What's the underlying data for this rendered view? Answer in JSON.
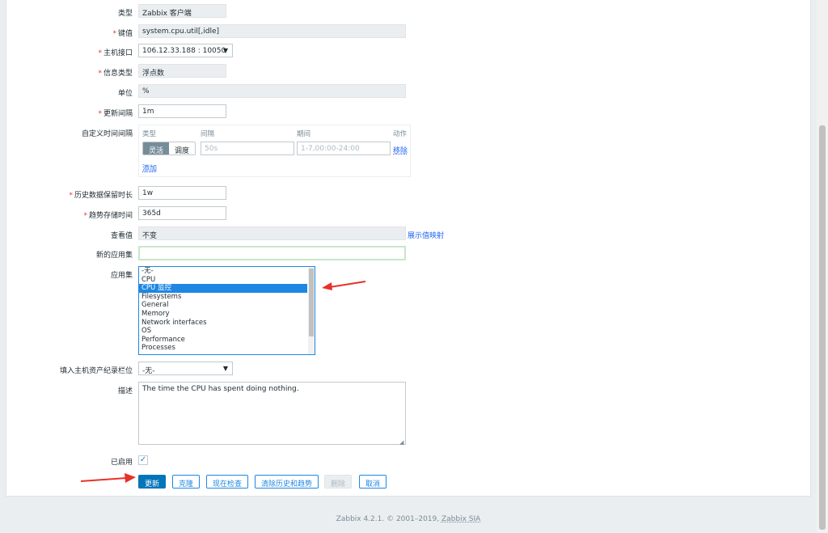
{
  "form": {
    "type": {
      "label": "类型",
      "value": "Zabbix 客户端"
    },
    "key": {
      "label": "键值",
      "value": "system.cpu.util[,idle]"
    },
    "interface": {
      "label": "主机接口",
      "value": "106.12.33.188 : 10050"
    },
    "info_type": {
      "label": "信息类型",
      "value": "浮点数"
    },
    "units": {
      "label": "单位",
      "value": "%"
    },
    "interval": {
      "label": "更新间隔",
      "value": "1m"
    },
    "custom_intervals": {
      "label": "自定义时间间隔",
      "col_type": "类型",
      "col_interval": "间隔",
      "col_period": "期间",
      "col_action": "动作",
      "flexible": "灵活",
      "scheduling": "调度",
      "interval_placeholder": "50s",
      "period_placeholder": "1-7,00:00-24:00",
      "remove": "移除",
      "add": "添加"
    },
    "history": {
      "label": "历史数据保留时长",
      "value": "1w"
    },
    "trends": {
      "label": "趋势存储时间",
      "value": "365d"
    },
    "valuemap": {
      "label": "查看值",
      "value": "不变",
      "link": "展示值映射"
    },
    "new_application": {
      "label": "新的应用集",
      "value": ""
    },
    "applications": {
      "label": "应用集",
      "options": [
        "-无-",
        "CPU",
        "CPU 监控",
        "Filesystems",
        "General",
        "Memory",
        "Network interfaces",
        "OS",
        "Performance",
        "Processes"
      ],
      "selected": "CPU 监控"
    },
    "inventory": {
      "label": "填入主机资产纪录栏位",
      "value": "-无-"
    },
    "description": {
      "label": "描述",
      "value": "The time the CPU has spent doing nothing."
    },
    "enabled": {
      "label": "已启用"
    }
  },
  "buttons": {
    "update": "更新",
    "clone": "克隆",
    "check_now": "现在检查",
    "clear": "清除历史和趋势",
    "delete": "删除",
    "cancel": "取消"
  },
  "footer": {
    "text": "Zabbix 4.2.1. © 2001–2019, ",
    "company": "Zabbix SIA"
  },
  "colors": {
    "accent": "#1e87e3",
    "primary": "#0275b8",
    "required": "#e33734",
    "annotation_arrow": "#e8312a"
  }
}
